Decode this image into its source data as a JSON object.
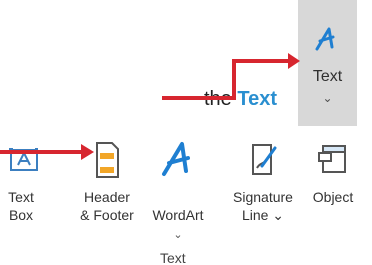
{
  "instruction": {
    "prefix": "the ",
    "highlight": "Text"
  },
  "zoom": {
    "label": "Text",
    "chevron": "⌄"
  },
  "ribbon": {
    "group_label": "Text",
    "commands": [
      {
        "label": "Text\nBox",
        "icon": "text-box-icon"
      },
      {
        "label": "Header\n& Footer",
        "icon": "header-footer-icon"
      },
      {
        "label": "WordArt",
        "icon": "wordart-icon",
        "chevron": "⌄"
      },
      {
        "label": "Signature\nLine ⌄",
        "icon": "signature-line-icon"
      },
      {
        "label": "Object",
        "icon": "object-icon"
      }
    ]
  },
  "colors": {
    "arrow": "#d7262f",
    "accent": "#2a8fd0",
    "panel": "#d8d8d8"
  }
}
